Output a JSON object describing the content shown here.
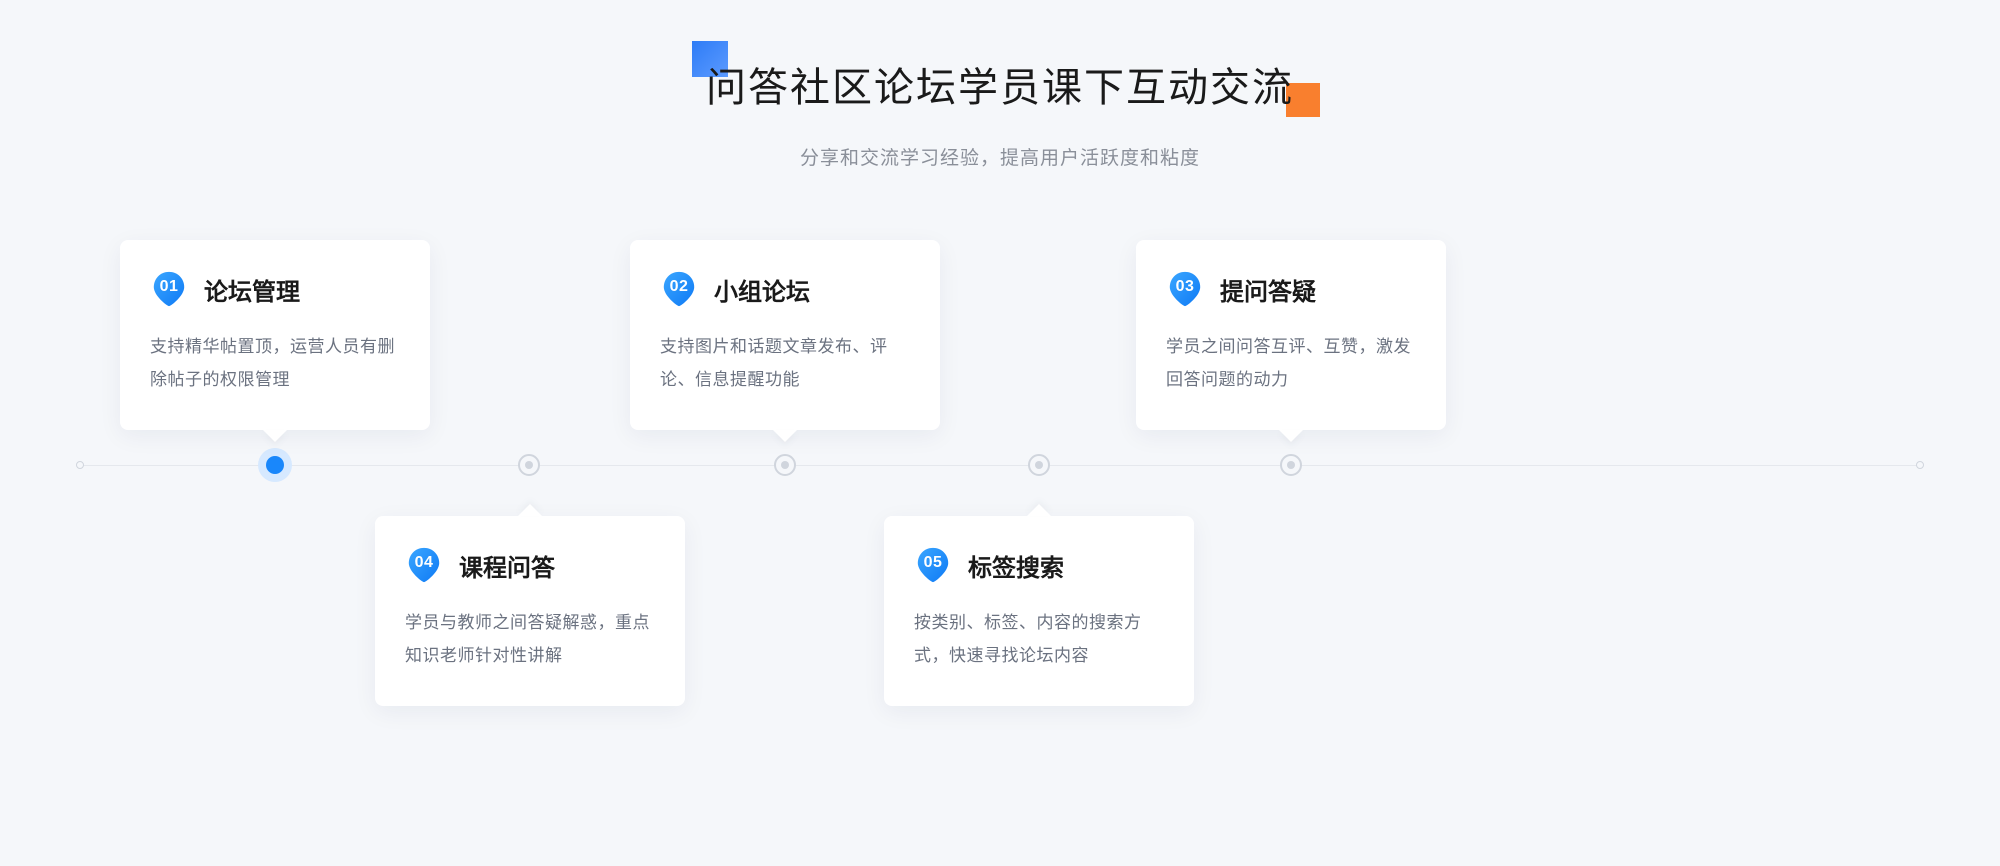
{
  "header": {
    "title": "问答社区论坛学员课下互动交流",
    "subtitle": "分享和交流学习经验，提高用户活跃度和粘度"
  },
  "cards": {
    "c1": {
      "num": "01",
      "title": "论坛管理",
      "desc": "支持精华帖置顶，运营人员有删除帖子的权限管理"
    },
    "c2": {
      "num": "02",
      "title": "小组论坛",
      "desc": "支持图片和话题文章发布、评论、信息提醒功能"
    },
    "c3": {
      "num": "03",
      "title": "提问答疑",
      "desc": "学员之间问答互评、互赞，激发回答问题的动力"
    },
    "c4": {
      "num": "04",
      "title": "课程问答",
      "desc": "学员与教师之间答疑解惑，重点知识老师针对性讲解"
    },
    "c5": {
      "num": "05",
      "title": "标签搜索",
      "desc": "按类别、标签、内容的搜索方式，快速寻找论坛内容"
    }
  }
}
